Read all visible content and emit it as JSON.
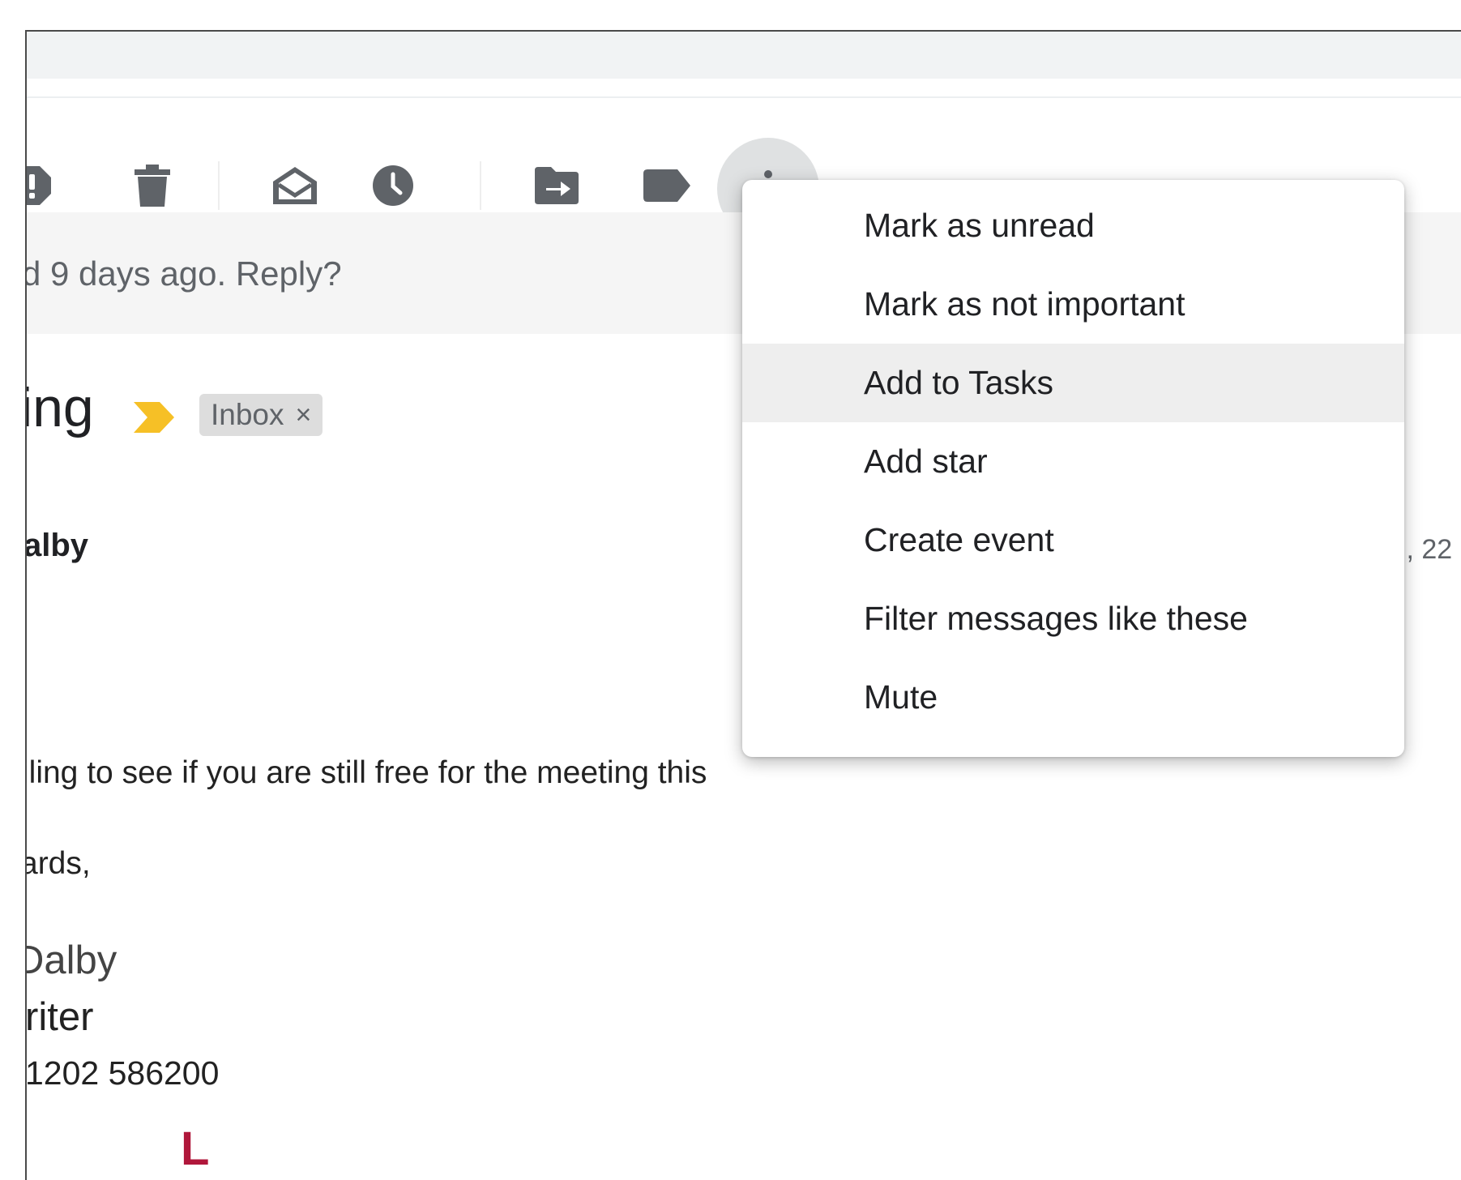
{
  "toolbar": {
    "buttons": [
      {
        "name": "report-spam-icon",
        "label": "Report spam"
      },
      {
        "name": "delete-icon",
        "label": "Delete"
      },
      {
        "name": "mark-as-read-icon",
        "label": "Mark as read"
      },
      {
        "name": "snooze-icon",
        "label": "Snooze"
      },
      {
        "name": "move-to-icon",
        "label": "Move to"
      },
      {
        "name": "labels-icon",
        "label": "Labels"
      },
      {
        "name": "more-vert-icon",
        "label": "More"
      }
    ]
  },
  "nudge": {
    "text": "d 9 days ago. Reply?"
  },
  "message": {
    "subject": "ing",
    "importance_color": "#f6c026",
    "label": "Inbox",
    "label_remove": "×",
    "sender": "alby",
    "date": "ı, 22",
    "body": "iling to see if you are still free for the meeting this",
    "regards": "ards,",
    "signature": {
      "name": "Dalby",
      "title": "riter",
      "phone": "1202 586200",
      "logo": "L",
      "logo_color": "#b0173b"
    }
  },
  "menu": {
    "items": [
      {
        "label": "Mark as unread",
        "hover": false
      },
      {
        "label": "Mark as not important",
        "hover": false
      },
      {
        "label": "Add to Tasks",
        "hover": true
      },
      {
        "label": "Add star",
        "hover": false
      },
      {
        "label": "Create event",
        "hover": false
      },
      {
        "label": "Filter messages like these",
        "hover": false
      },
      {
        "label": "Mute",
        "hover": false
      }
    ]
  },
  "colors": {
    "icon": "#5f6368",
    "menu_hover": "#eeeeee",
    "nudge_bg": "#f5f5f5"
  }
}
